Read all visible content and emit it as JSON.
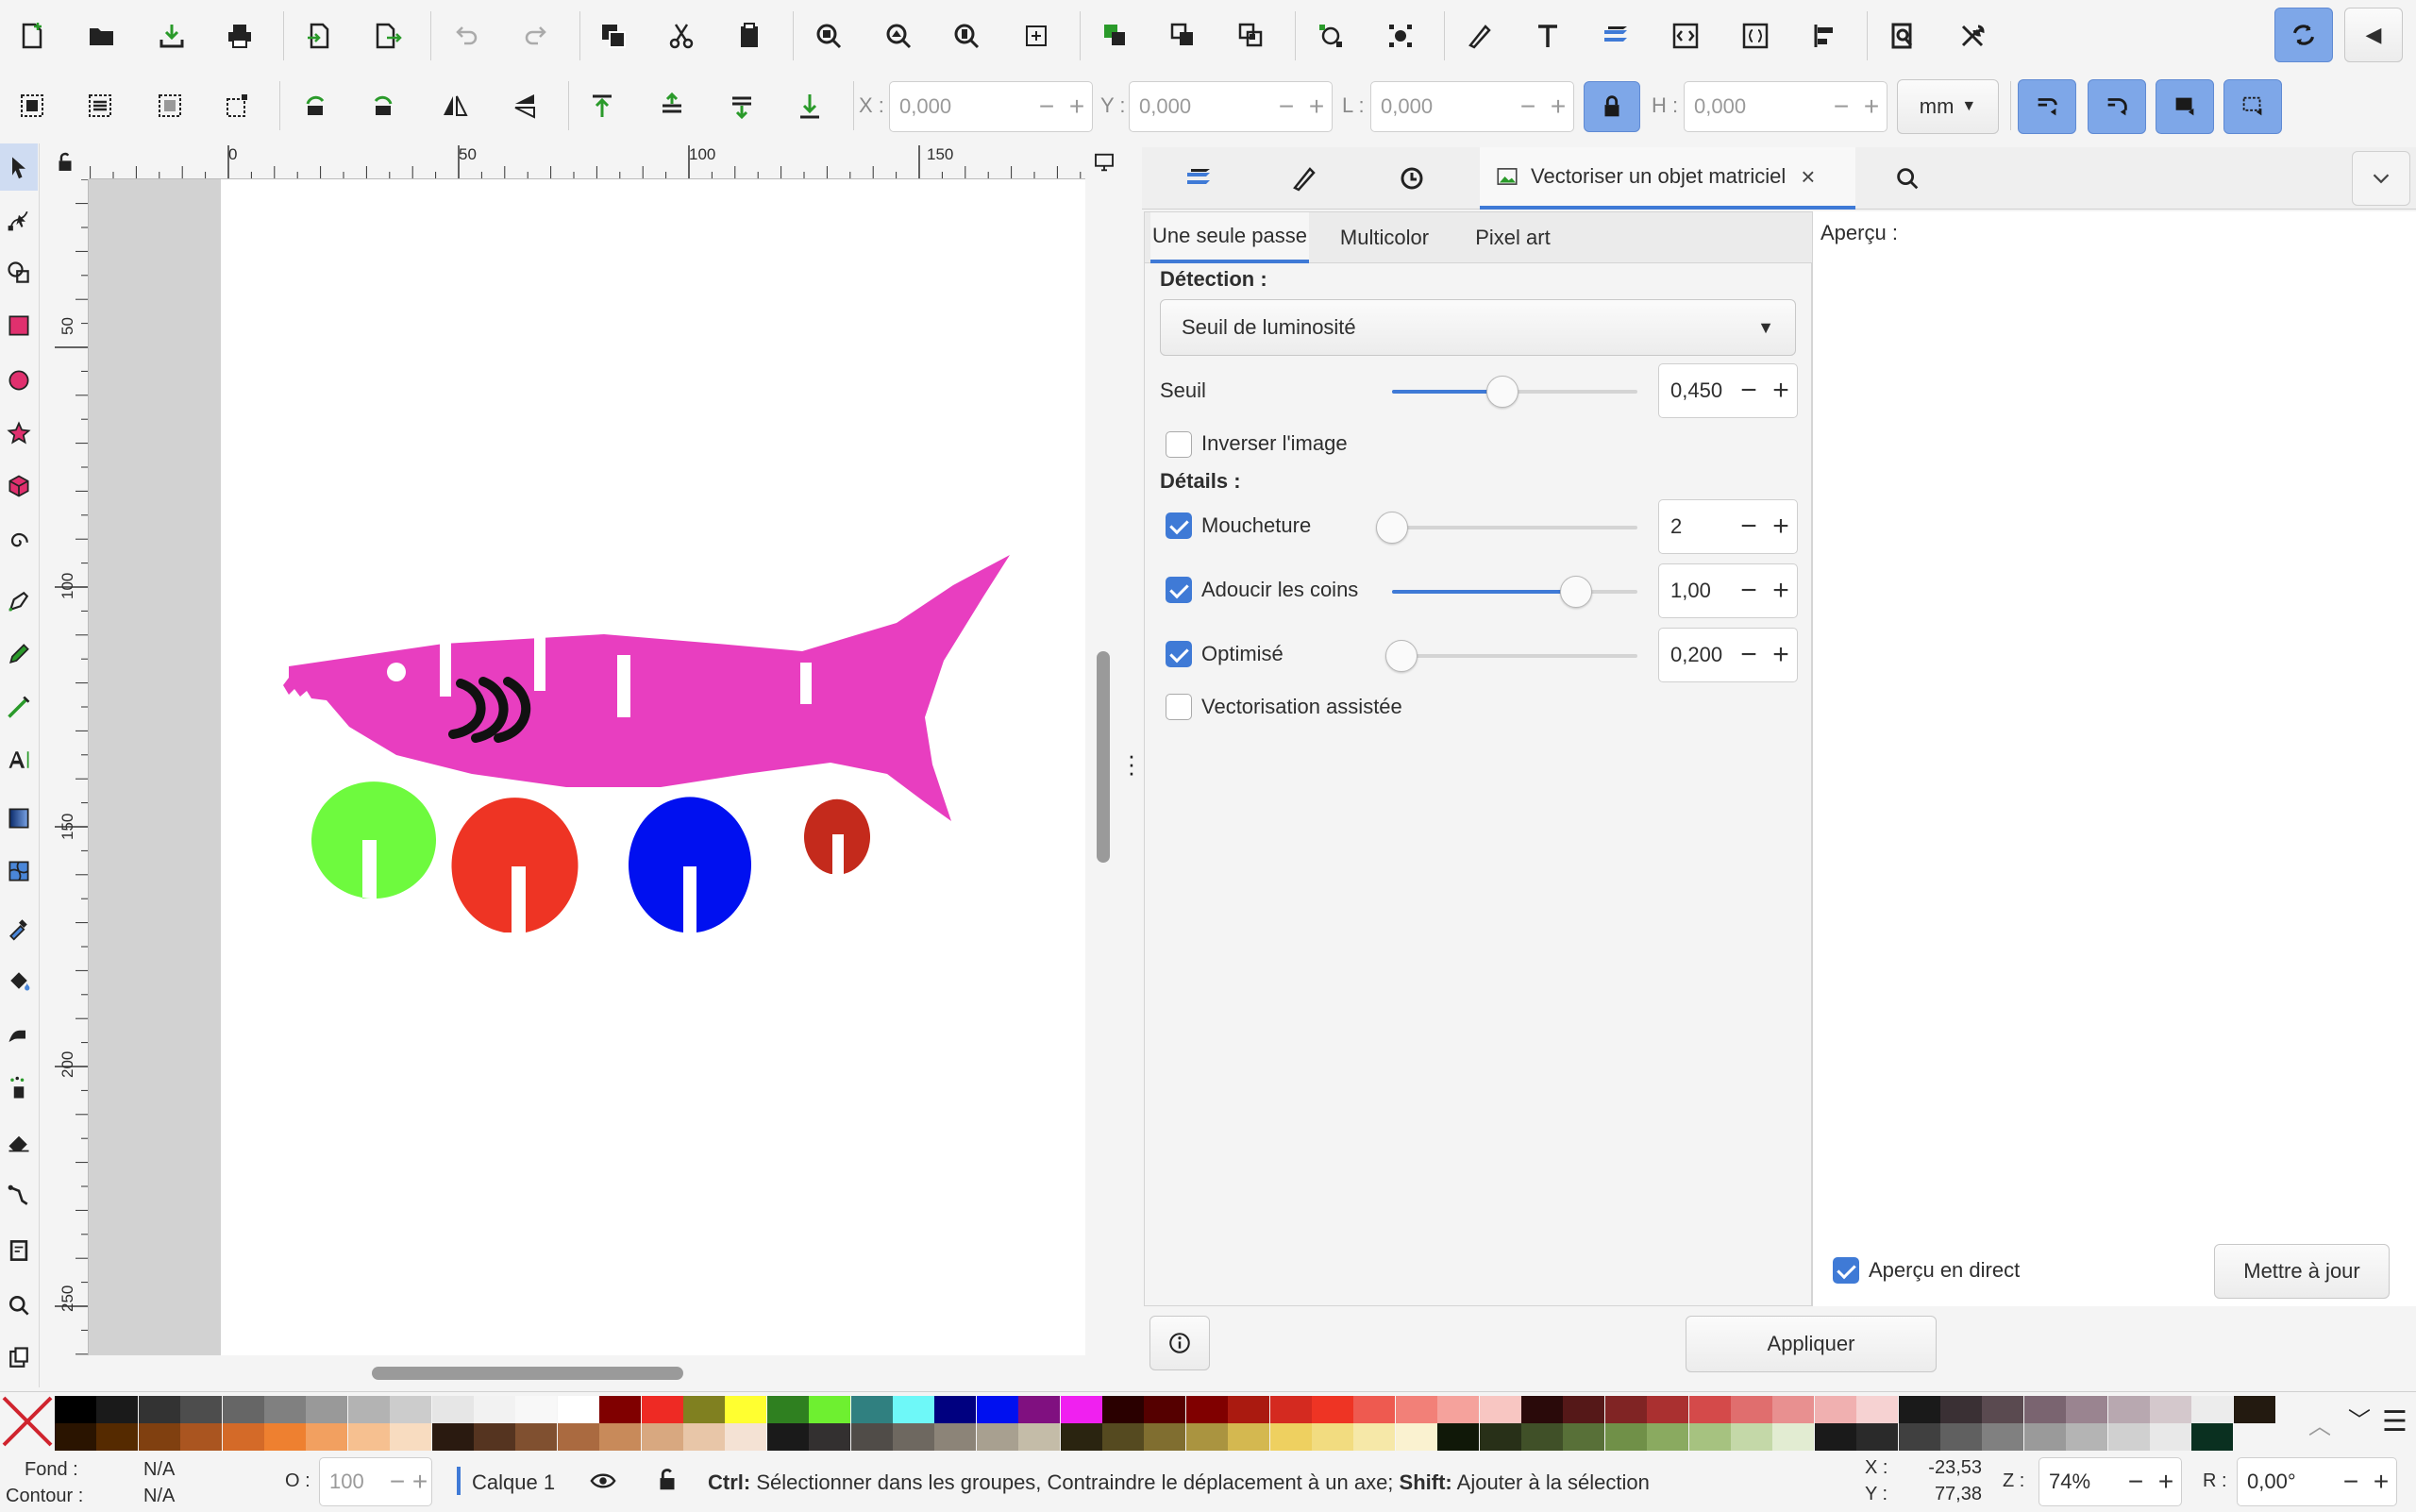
{
  "colors": {
    "accent": "#3f7ad6",
    "shark": "#e83ec0",
    "green": "#6efa3e",
    "red": "#ee3424",
    "blue": "#0010f0",
    "darkred": "#c42a1c"
  },
  "toolbar": {
    "x_label": "X :",
    "x_value": "0,000",
    "y_label": "Y :",
    "y_value": "0,000",
    "w_label": "L :",
    "w_value": "0,000",
    "h_label": "H :",
    "h_value": "0,000",
    "unit": "mm"
  },
  "ruler": {
    "marks": [
      "0",
      "50",
      "100",
      "150"
    ],
    "vmarks": [
      "50",
      "100",
      "150",
      "200",
      "250"
    ]
  },
  "dock": {
    "tab_title": "Vectoriser un objet matriciel",
    "subtabs": [
      "Une seule passe",
      "Multicolor",
      "Pixel art"
    ],
    "detection_label": "Détection :",
    "detection_value": "Seuil de luminosité",
    "threshold_label": "Seuil",
    "threshold_value": "0,450",
    "threshold_level": 0.45,
    "invert_label": "Inverser l'image",
    "details_label": "Détails :",
    "speckles_label": "Moucheture",
    "speckles_value": "2",
    "speckles_level": 0.0,
    "smooth_label": "Adoucir les coins",
    "smooth_value": "1,00",
    "smooth_level": 0.75,
    "optimize_label": "Optimisé",
    "optimize_value": "0,200",
    "optimize_level": 0.04,
    "assisted_label": "Vectorisation assistée",
    "preview_label": "Aperçu :",
    "live_preview_label": "Aperçu en direct",
    "update_label": "Mettre à jour",
    "apply_label": "Appliquer"
  },
  "status": {
    "fill_label": "Fond :",
    "fill_value": "N/A",
    "stroke_label": "Contour :",
    "stroke_value": "N/A",
    "opacity_label": "O :",
    "opacity_value": "100",
    "layer": "Calque 1",
    "hint_ctrl": "Ctrl:",
    "hint_ctrl_text": " Sélectionner dans les groupes, Contraindre le déplacement à un axe; ",
    "hint_shift": "Shift:",
    "hint_shift_text": " Ajouter à la sélection",
    "cx_label": "X :",
    "cx_value": "-23,53",
    "cy_label": "Y :",
    "cy_value": "77,38",
    "zoom_label": "Z :",
    "zoom_value": "74%",
    "rot_label": "R :",
    "rot_value": "0,00°"
  },
  "palette_top": [
    "#000000",
    "#1a1a1a",
    "#333333",
    "#4d4d4d",
    "#666666",
    "#808080",
    "#999999",
    "#b3b3b3",
    "#cccccc",
    "#e6e6e6",
    "#f2f2f2",
    "#f8f8f8",
    "#ffffff",
    "#800000",
    "#ee2a24",
    "#808020",
    "#ffff30",
    "#2f8020",
    "#6ef030",
    "#308080",
    "#6ef8f8",
    "#000080",
    "#0010f0",
    "#801080",
    "#f020f0",
    "#2a0000",
    "#550000",
    "#800000",
    "#aa1a10",
    "#d42a20",
    "#ee3424",
    "#ee5a50",
    "#f28078",
    "#f5a29c",
    "#f8c6c2",
    "#2a0a0a",
    "#551818",
    "#802424",
    "#aa3030",
    "#d44a4a",
    "#e06e6e",
    "#e89090",
    "#f0b0b0",
    "#f6d2d2",
    "#1a1a1a",
    "#3a3034",
    "#5a4a50",
    "#7a6470",
    "#9a8490",
    "#b8a8b0",
    "#d4c8cc",
    "#ececec",
    "#231a10"
  ],
  "palette_bottom": [
    "#2a1400",
    "#552a00",
    "#804010",
    "#aa5520",
    "#d46a28",
    "#ee8030",
    "#f2a060",
    "#f6c090",
    "#f8dcc0",
    "#2a1a10",
    "#553420",
    "#805030",
    "#aa6a40",
    "#c88a5a",
    "#d8a880",
    "#e8c6a8",
    "#f4e2d4",
    "#1a1a1a",
    "#333030",
    "#504c48",
    "#6e6860",
    "#8c8478",
    "#a8a090",
    "#c4bca8",
    "#2a2410",
    "#554a20",
    "#806e30",
    "#aa9440",
    "#d4b850",
    "#eed060",
    "#f2dc80",
    "#f6e8a8",
    "#faf2d0",
    "#101808",
    "#283018",
    "#405028",
    "#587038",
    "#709048",
    "#8aaa60",
    "#a6c280",
    "#c4d8a8",
    "#e2ecd2",
    "#1a1a1a",
    "#2a2a2a",
    "#404040",
    "#606060",
    "#808080",
    "#9a9a9a",
    "#b4b4b4",
    "#d0d0d0",
    "#e8e8e8",
    "#0a3020"
  ]
}
